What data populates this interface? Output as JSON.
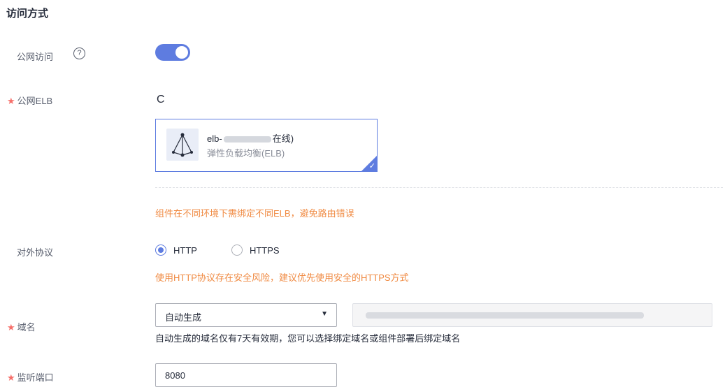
{
  "section": {
    "title": "访问方式"
  },
  "public_access": {
    "label": "公网访问",
    "help_glyph": "?",
    "enabled": true
  },
  "public_elb": {
    "required_mark": "★",
    "label": "公网ELB",
    "refresh_glyph": "C",
    "card": {
      "name_prefix": "elb-",
      "name_suffix": "在线)",
      "type": "弹性负载均衡(ELB)",
      "selected": true
    },
    "warning": "组件在不同环境下需绑定不同ELB，避免路由错误"
  },
  "protocol": {
    "label": "对外协议",
    "options": [
      {
        "label": "HTTP",
        "checked": true
      },
      {
        "label": "HTTPS",
        "checked": false
      }
    ],
    "warning": "使用HTTP协议存在安全风险，建议优先使用安全的HTTPS方式"
  },
  "domain": {
    "required_mark": "★",
    "label": "域名",
    "select_value": "自动生成",
    "hint": "自动生成的域名仅有7天有效期，您可以选择绑定域名或组件部署后绑定域名"
  },
  "listen_port": {
    "required_mark": "★",
    "label": "监听端口",
    "value": "8080"
  },
  "colors": {
    "primary": "#5e7ce0",
    "warning": "#f08a42",
    "required": "#f66f6a"
  },
  "icons": {
    "help": "question-circle-icon",
    "refresh": "refresh-icon",
    "elb": "elb-icon",
    "select": "caret-down-icon",
    "check": "check-icon"
  }
}
